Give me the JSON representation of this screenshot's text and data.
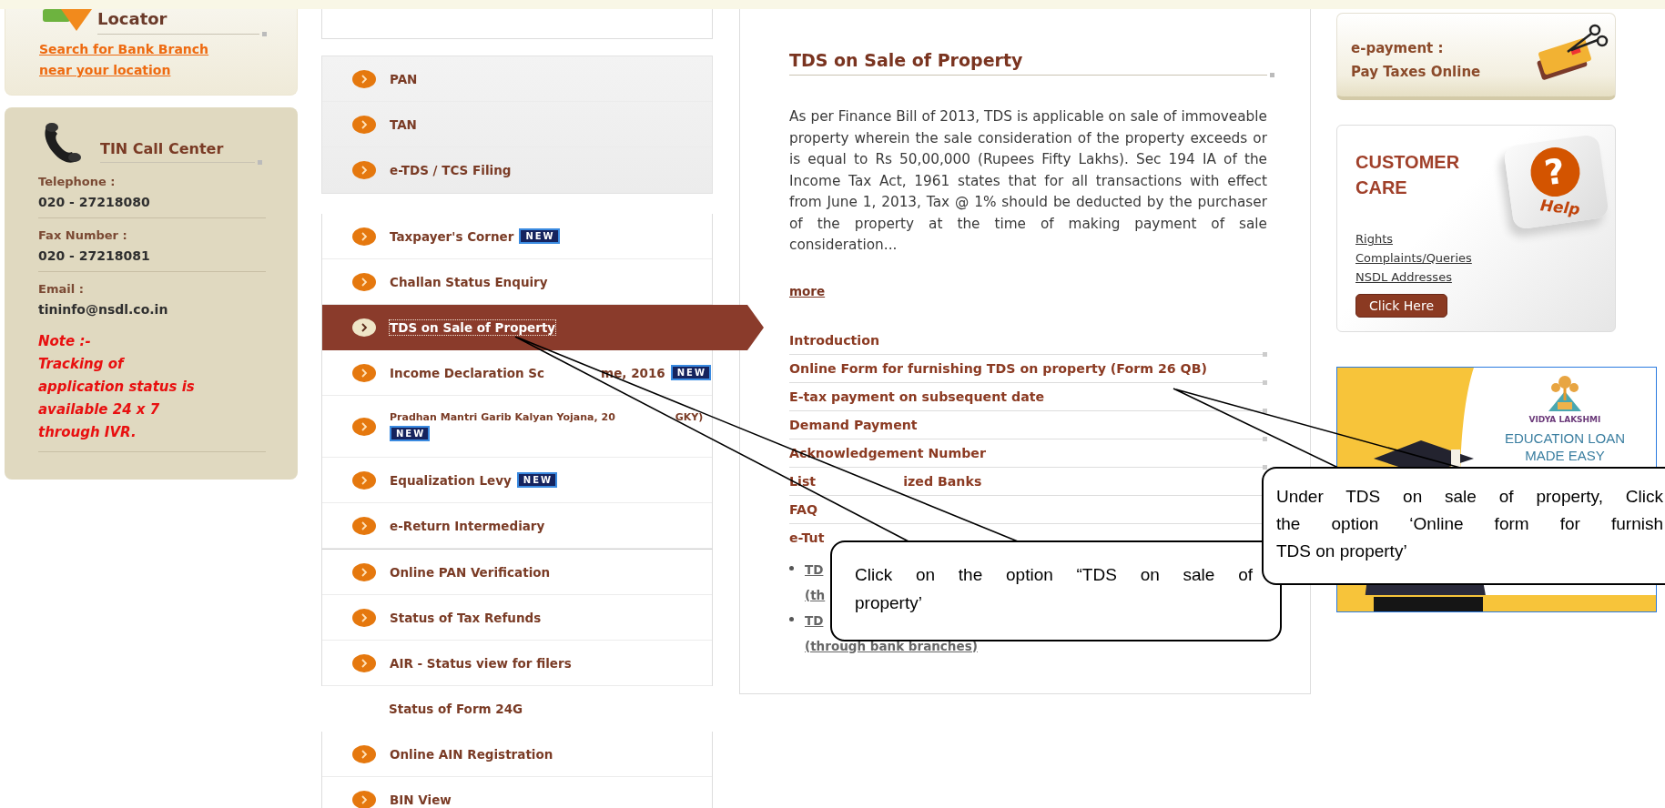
{
  "locator": {
    "title": "Locator",
    "link": [
      "Search for Bank Branch",
      "near your location"
    ]
  },
  "call_center": {
    "title": "TIN Call Center",
    "entries": [
      {
        "label": "Telephone :",
        "value": "020 - 27218080"
      },
      {
        "label": "Fax Number :",
        "value": "020 - 27218081"
      },
      {
        "label": "Email :",
        "value": "tininfo@nsdl.co.in"
      }
    ],
    "note": [
      "Note :-",
      "Tracking of",
      "application status is",
      "available 24 x 7",
      "through IVR."
    ]
  },
  "menu": {
    "groups": [
      {
        "shaded": true,
        "items": [
          {
            "kind": "link",
            "label": "PAN",
            "selected": false
          },
          {
            "kind": "link",
            "label": "TAN",
            "selected": false
          },
          {
            "kind": "link",
            "label": "e-TDS / TCS Filing",
            "selected": false
          }
        ]
      },
      {
        "shaded": false,
        "items": [
          {
            "kind": "link",
            "label": "Taxpayer's Corner",
            "badge": "NEW",
            "selected": false
          },
          {
            "kind": "link",
            "label": "Challan Status Enquiry",
            "selected": false
          },
          {
            "kind": "link",
            "label": "TDS on Sale of Property",
            "selected": true
          },
          {
            "kind": "link",
            "parts": [
              "Income Declaration Sc",
              "me, 2016"
            ],
            "badge": "NEW",
            "selected": false
          },
          {
            "kind": "small",
            "parts": [
              "Pradhan Mantri Garib Kalyan Yojana, 20",
              "GKY)"
            ],
            "badge": "NEW",
            "selected": false
          },
          {
            "kind": "link",
            "label": "Equalization Levy",
            "badge": "NEW",
            "selected": false
          },
          {
            "kind": "link",
            "label": "e-Return Intermediary",
            "selected": false
          }
        ]
      },
      {
        "shaded": false,
        "items": [
          {
            "kind": "link",
            "label": "Online PAN Verification",
            "selected": false
          },
          {
            "kind": "link",
            "label": "Status of Tax Refunds",
            "selected": false
          },
          {
            "kind": "link",
            "label": "AIR - Status view for filers",
            "selected": false
          },
          {
            "kind": "sub",
            "label": "Status of Form 24G",
            "selected": false
          },
          {
            "kind": "link",
            "label": "Online AIN Registration",
            "selected": false
          },
          {
            "kind": "link",
            "label": "BIN View",
            "selected": false
          }
        ]
      }
    ]
  },
  "content": {
    "title": "TDS on Sale of Property",
    "body": "As per Finance Bill of 2013, TDS is applicable on sale of immoveable property wherein the sale consideration of the property exceeds or is equal to Rs 50,00,000 (Rupees Fifty Lakhs). Sec 194 IA of the Income Tax Act, 1961 states that for all transactions with effect from June 1, 2013, Tax @ 1% should be deducted by the purchaser of the property at the time of making payment of sale consideration...",
    "more": "more",
    "links": [
      {
        "label": "Introduction"
      },
      {
        "label": "Online Form for furnishing TDS on property (Form 26 QB)"
      },
      {
        "label": "E-tax payment on subsequent date"
      },
      {
        "label": "Demand Payment"
      },
      {
        "label": "Acknowledgement Number"
      },
      {
        "parts": [
          "List",
          "ized Banks"
        ]
      },
      {
        "label": "FAQ"
      },
      {
        "label": "e-Tut"
      }
    ],
    "tutorials": [
      {
        "lines": [
          "TD",
          "(th"
        ]
      },
      {
        "lines": [
          "TD",
          "(through bank branches)"
        ]
      }
    ]
  },
  "epayment": {
    "lines": [
      "e-payment :",
      "Pay Taxes Online"
    ]
  },
  "customer_care": {
    "title": [
      "CUSTOMER",
      "CARE"
    ],
    "key_symbol": "?",
    "key_label": "Help",
    "links": [
      "Rights",
      "Complaints/Queries",
      "NSDL Addresses"
    ],
    "button": "Click Here"
  },
  "banner": {
    "brand": "VIDYA LAKSHMI",
    "headline": [
      "EDUCATION LOAN",
      "MADE EASY"
    ]
  },
  "callouts": [
    {
      "lines": [
        "Click on the option “TDS on sale of",
        "property’"
      ]
    },
    {
      "lines": [
        "Under TDS on sale of property, Click",
        "the option ‘Online form for furnish",
        "TDS on property’"
      ]
    }
  ]
}
